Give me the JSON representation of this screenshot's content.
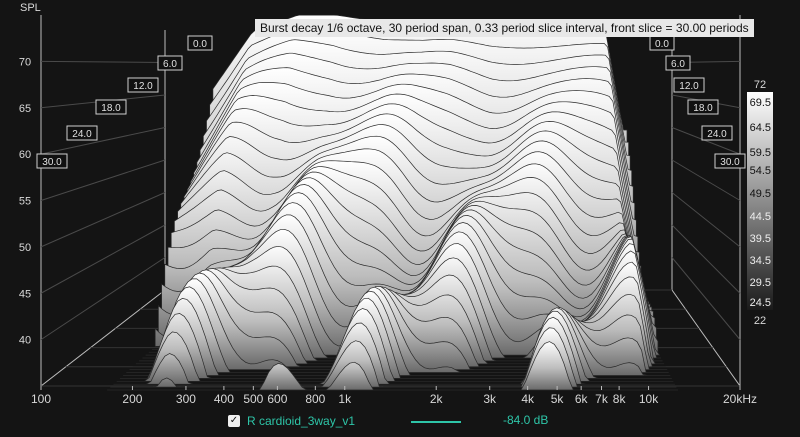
{
  "chart_data": {
    "type": "waterfall",
    "title": "Burst decay 1/6 octave, 30 period span, 0.33 period slice interval,  front slice = 30.00 periods",
    "ylabel": "SPL",
    "xunit": "kHz",
    "y_ticks": [
      "70",
      "65",
      "60",
      "55",
      "50",
      "45",
      "40"
    ],
    "x_ticks": [
      "100",
      "200",
      "300",
      "400",
      "500",
      "600",
      "800",
      "1k",
      "2k",
      "3k",
      "4k",
      "5k",
      "6k",
      "7k",
      "8k",
      "10k",
      "20kHz"
    ],
    "x_tick_freqs": [
      100,
      200,
      300,
      400,
      500,
      600,
      800,
      1000,
      2000,
      3000,
      4000,
      5000,
      6000,
      7000,
      8000,
      10000,
      20000
    ],
    "z_ticks_left": [
      "0.0",
      "6.0",
      "12.0",
      "18.0",
      "24.0",
      "30.0"
    ],
    "z_ticks_right": [
      "0.0",
      "6.0",
      "12.0",
      "18.0",
      "24.0",
      "30.0"
    ],
    "colorbar_labels": [
      "72",
      "69.5",
      "64.5",
      "59.5",
      "54.5",
      "49.5",
      "44.5",
      "39.5",
      "34.5",
      "29.5",
      "24.5",
      "22"
    ],
    "colorbar_range": [
      22,
      72
    ],
    "front_slice_profile": {
      "freq_hz": [
        160,
        250,
        400,
        600,
        800,
        1000,
        1500,
        2000,
        3000,
        4000,
        5000,
        6000,
        8000,
        10000,
        12000
      ],
      "spl_db": [
        62.5,
        70.0,
        72.0,
        72.0,
        71.5,
        71.0,
        70.5,
        70.5,
        70.0,
        70.0,
        70.0,
        70.0,
        70.0,
        70.0,
        58.0
      ]
    },
    "series": [
      {
        "name": "R cardioid_3way_v1",
        "level": "-84.0 dB",
        "color": "#2ec5a8",
        "checked": true
      }
    ]
  }
}
